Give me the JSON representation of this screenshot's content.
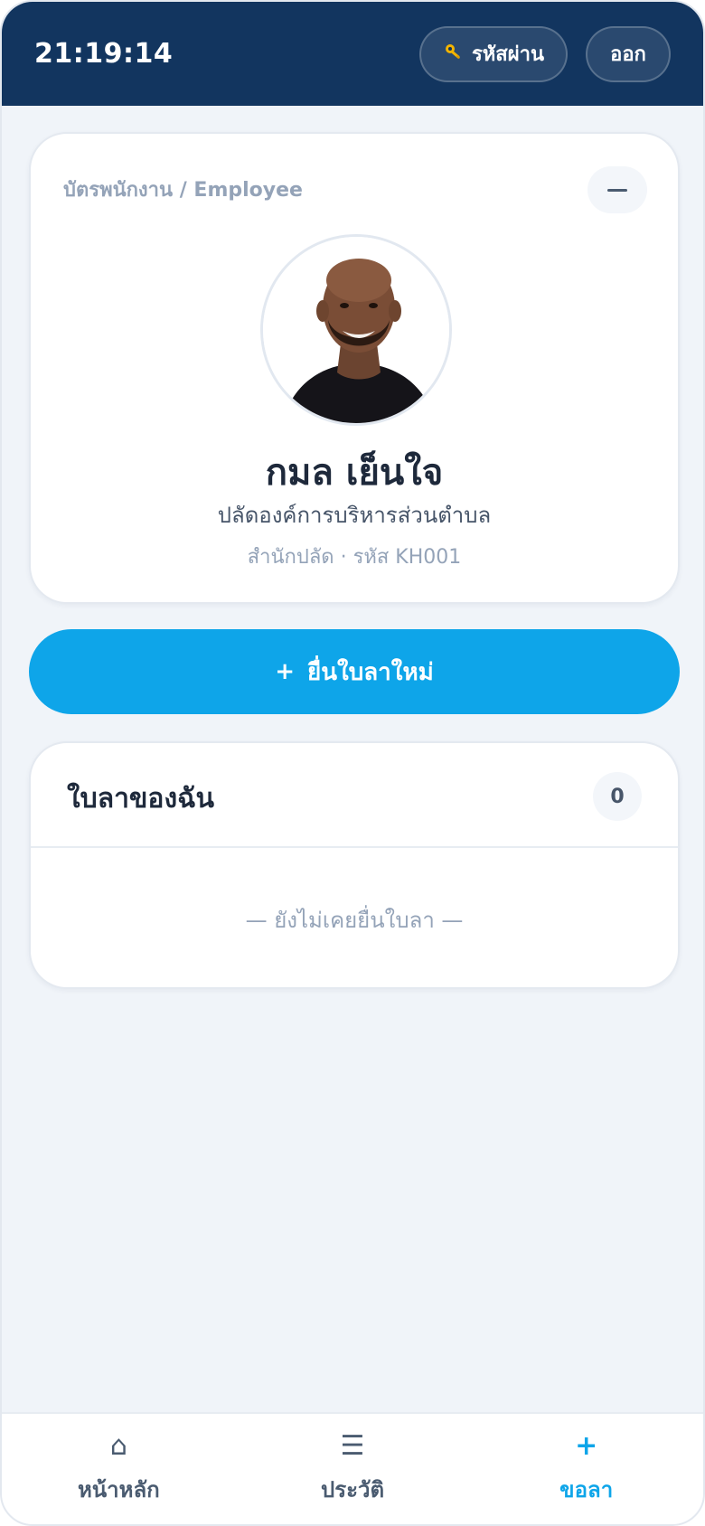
{
  "header": {
    "clock": "21:19:14",
    "password_button": {
      "icon": "key-icon",
      "label": "รหัสผ่าน"
    },
    "logout_button": {
      "label": "ออก"
    }
  },
  "employee_card": {
    "label": "บัตรพนักงาน / Employee",
    "collapse_icon": "minus-icon",
    "name": "กมล เย็นใจ",
    "position": "ปลัดองค์การบริหารส่วนตำบล",
    "department_line": "สำนักปลัด · รหัส KH001"
  },
  "new_leave_button": {
    "icon": "+",
    "label": "ยื่นใบลาใหม่"
  },
  "my_leaves": {
    "title": "ใบลาของฉัน",
    "count": "0",
    "empty_text": "— ยังไม่เคยยื่นใบลา —"
  },
  "bottom_nav": {
    "items": [
      {
        "icon": "⌂",
        "icon_name": "home-icon",
        "label": "หน้าหลัก",
        "active": false
      },
      {
        "icon": "☰",
        "icon_name": "list-icon",
        "label": "ประวัติ",
        "active": false
      },
      {
        "icon": "+",
        "icon_name": "plus-icon",
        "label": "ขอลา",
        "active": true
      }
    ]
  },
  "colors": {
    "header_bg": "#12355f",
    "accent": "#0ea5e9",
    "page_bg": "#f0f4f9"
  }
}
